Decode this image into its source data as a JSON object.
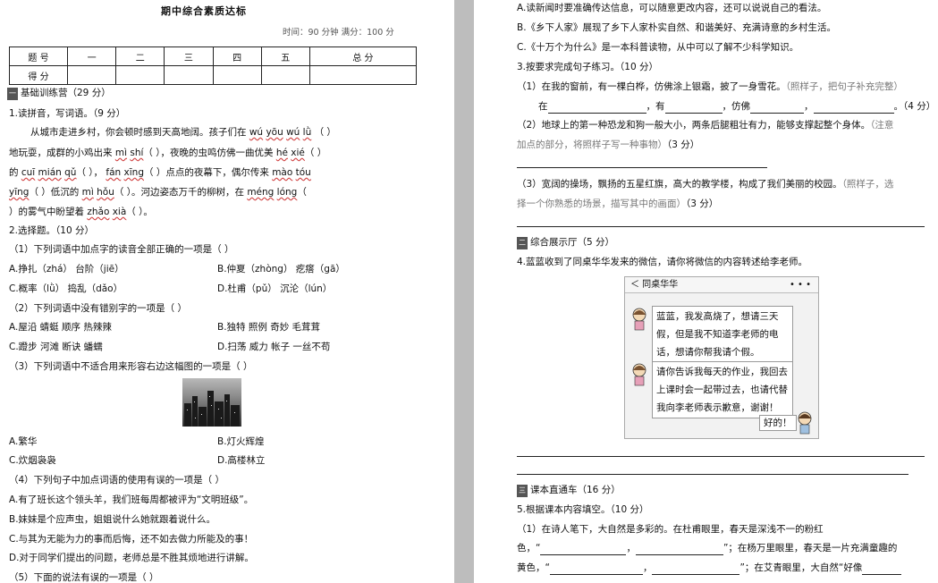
{
  "left": {
    "title": "期中综合素质达标",
    "meta": "时间：90 分钟    满分：100 分",
    "score_table": {
      "row1": [
        "题  号",
        "一",
        "二",
        "三",
        "四",
        "五",
        "总  分"
      ],
      "row2_label": "得  分"
    },
    "sec1": {
      "num": "一",
      "title": "基础训练营（29 分）"
    },
    "q1": {
      "head": "1.读拼音，写词语。（9 分）",
      "l1a": "从城市走进乡村，你会顿时感到天高地阔。孩子们在",
      "l1py": [
        "wú",
        "yōu",
        "wú",
        "lǜ"
      ],
      "l1b": "（                ）",
      "l2a": "地玩耍，成群的小鸡出来",
      "l2py1": [
        "mì",
        "shí"
      ],
      "l2b": "（          ），夜晚的虫鸣仿佛一曲优美",
      "l2py2": [
        "hé",
        "xié"
      ],
      "l2c": "（          ）",
      "l3a": "的",
      "l3py1": [
        "cuī",
        "mián",
        "qǔ"
      ],
      "l3b": "（          ），",
      "l3py2": [
        "fán",
        "xīng"
      ],
      "l3c": "（          ）点点的夜幕下，偶尔传来",
      "l3py3": [
        "mào",
        "tóu"
      ],
      "l4py1": "yīng",
      "l4a": "（          ）低沉的",
      "l4py2": [
        "mì",
        "hǒu"
      ],
      "l4b": "（          ）。河边姿态万千的柳树，在",
      "l4py3": [
        "méng",
        "lóng"
      ],
      "l4c": "（",
      "l5a": "     ）的雾气中盼望着",
      "l5py": [
        "zhǎo",
        "xià"
      ],
      "l5b": "（          ）。"
    },
    "q2": {
      "head": "2.选择题。（10 分）",
      "s1": "（1）下列词语中加点字的读音全部正确的一项是（         ）",
      "s1A": "A.挣扎（zhá）    台阶（jiē）",
      "s1B": "B.仲夏（zhòng）    疙瘩（gā）",
      "s1C": "C.概率（lǜ）    捣乱（dǎo）",
      "s1D": "D.杜甫（pǔ）    沉沦（lún）",
      "s2": "（2）下列词语中没有错别字的一项是（         ）",
      "s2A": "A.屋沿    蜻蜓    顺序    热辣辣",
      "s2B": "B.独特    照例    奇妙    毛茸茸",
      "s2C": "C.蹬步    河滩    断诀    蟠蠕",
      "s2D": "D.扫荡    威力    帐子    一丝不苟",
      "s3": "（3）下列词语中不适合用来形容右边这幅图的一项是（         ）",
      "s3A": "A.繁华",
      "s3B": "B.灯火辉煌",
      "s3C": "C.炊烟袅袅",
      "s3D": "D.高楼林立",
      "s4": "（4）下列句子中加点词语的使用有误的一项是（         ）",
      "s4A": "A.有了班长这个领头羊，我们班每周都被评为“文明班级”。",
      "s4B": "B.妹妹是个应声虫，姐姐说什么她就跟着说什么。",
      "s4C": "C.与其为无能为力的事而后悔，还不如去做力所能及的事！",
      "s4D": "D.对于同学们提出的问题，老师总是不胜其烦地进行讲解。",
      "s5": "（5）下面的说法有误的一项是（         ）"
    }
  },
  "right": {
    "r1": "A.读新闻时要准确传达信息，可以随意更改内容，还可以说说自己的看法。",
    "r2": "B.《乡下人家》展现了乡下人家朴实自然、和谐美好、充满诗意的乡村生活。",
    "r3": "C.《十万个为什么》是一本科普读物，从中可以了解不少科学知识。",
    "q3": {
      "head": "3.按要求完成句子练习。（10 分）",
      "s1": "（1）在我的窗前，有一棵白桦，仿佛涂上银霜，披了一身雪花。",
      "s1note": "（照样子，把句子补充完整）",
      "s1b_a": "在",
      "s1b_b": "，有",
      "s1b_c": "，仿佛",
      "s1b_d": "，",
      "s1b_e": "。（4 分）",
      "s2": "（2）地球上的第一种恐龙和狗一般大小，两条后腿粗壮有力，能够支撑起整个身体。",
      "s2note": "（注意",
      "s2b": "加点的部分，将照样子写一种事物）",
      "s2c": "（3 分）",
      "s3": "（3）宽阔的操场，飘扬的五星红旗，高大的教学楼，构成了我们美丽的校园。",
      "s3note": "（照样子，选",
      "s3b": "择一个你熟悉的场景，描写其中的画面）",
      "s3c": "（3 分）"
    },
    "sec2": {
      "num": "二",
      "title": "综合展示厅（5 分）"
    },
    "q4": {
      "head": "4.蓝蓝收到了同桌华华发来的微信，请你将微信的内容转述给李老师。",
      "chat_title": "＜  同桌华华",
      "chat_menu": "• • •",
      "m1": [
        "蓝蓝，我发高烧了，想请三天",
        "假，但是我不知道李老师的电",
        "话，想请你帮我请个假。"
      ],
      "m2": [
        "请你告诉我每天的作业，我回去",
        "上课时会一起带过去，也请代替",
        "我向李老师表示歉意，谢谢！"
      ],
      "reply": "好的！"
    },
    "sec3": {
      "num": "三",
      "title": "课本直通车（16 分）"
    },
    "q5": {
      "head": "5.根据课本内容填空。（10 分）",
      "s1": "（1）在诗人笔下，大自然是多彩的。在杜甫眼里，春天是深浅不一的粉红",
      "s1b_a": "色，“",
      "s1b_b": "，",
      "s1b_c": "”；在杨万里眼里，春天是一片充满童趣的",
      "s1c_a": "黄色，“",
      "s1c_b": "，",
      "s1c_c": "”；在艾青眼里，大自然“好像"
    }
  }
}
